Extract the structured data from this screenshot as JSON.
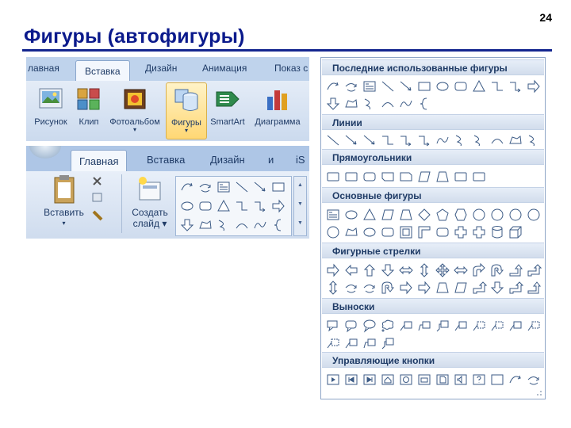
{
  "slide": {
    "title": "Фигуры (автофигуры)",
    "number": "24"
  },
  "ribbon1": {
    "tabs": [
      "лавная",
      "Вставка",
      "Дизайн",
      "Анимация",
      "Показ с"
    ],
    "active_tab": "Вставка",
    "buttons": [
      {
        "label": "Рисунок",
        "icon": "picture-icon"
      },
      {
        "label": "Клип",
        "icon": "clipart-icon"
      },
      {
        "label": "Фотоальбом",
        "icon": "photo-album-icon"
      },
      {
        "label": "Фигуры",
        "icon": "shapes-icon",
        "highlighted": true
      },
      {
        "label": "SmartArt",
        "icon": "smartart-icon"
      },
      {
        "label": "Диаграмма",
        "icon": "chart-icon"
      }
    ]
  },
  "ribbon2": {
    "tabs": [
      "Главная",
      "Вставка",
      "Дизайн",
      "и",
      "iS"
    ],
    "active_tab": "Главная",
    "paste_label": "Вставить",
    "new_slide_label_1": "Создать",
    "new_slide_label_2": "слайд"
  },
  "gallery": {
    "sections": [
      {
        "title": "Последние использованные фигуры"
      },
      {
        "title": "Линии"
      },
      {
        "title": "Прямоугольники"
      },
      {
        "title": "Основные фигуры"
      },
      {
        "title": "Фигурные стрелки"
      },
      {
        "title": "Выноски"
      },
      {
        "title": "Управляющие кнопки"
      }
    ]
  },
  "colors": {
    "title": "#0b1a8c",
    "rule": "#14268f",
    "ribbon": "#dbe6f4",
    "highlight": "#ffd774"
  }
}
